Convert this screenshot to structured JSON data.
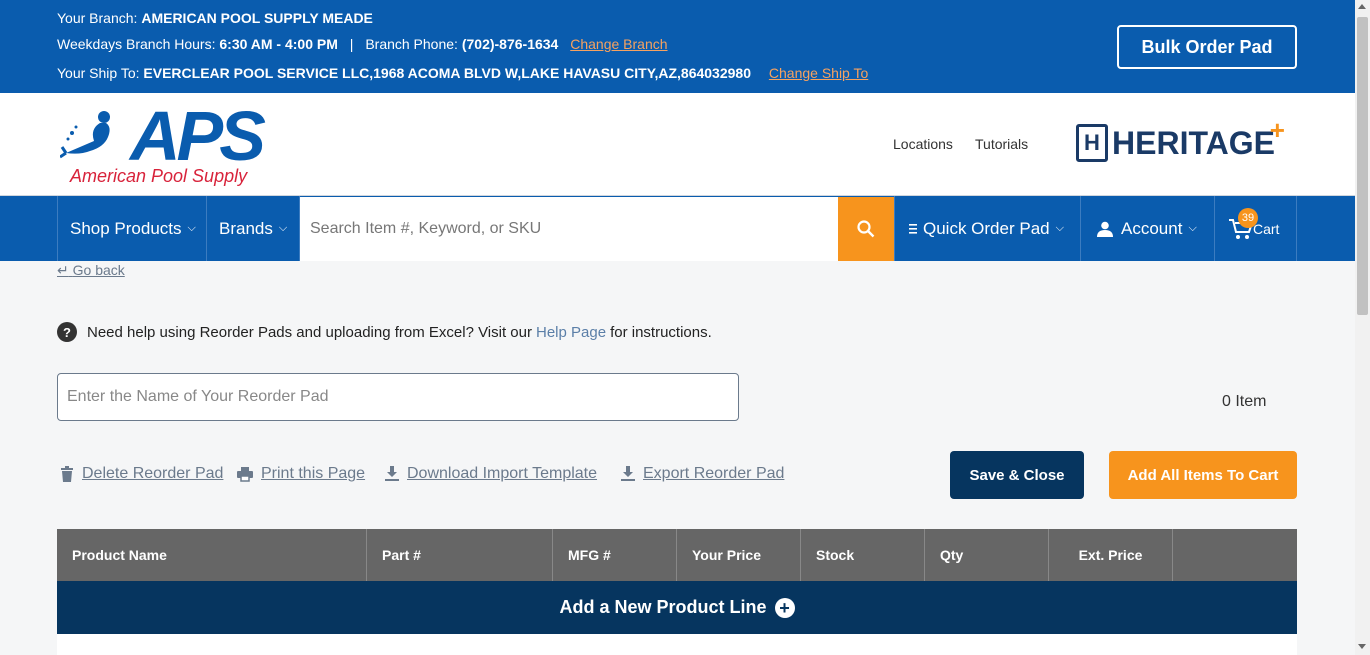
{
  "branch": {
    "branch_label": "Your Branch: ",
    "branch_name": "AMERICAN POOL SUPPLY MEADE",
    "hours_label": "Weekdays Branch Hours: ",
    "hours_value": "6:30 AM - 4:00 PM",
    "separator": "|",
    "phone_label": "Branch Phone: ",
    "phone_value": "(702)-876-1634",
    "change_branch": "Change Branch",
    "shipto_label": "Your Ship To: ",
    "shipto_value": "EVERCLEAR POOL SERVICE LLC,1968 ACOMA BLVD W,LAKE HAVASU CITY,AZ,864032980",
    "change_shipto": "Change Ship To",
    "bulk_order": "Bulk Order Pad"
  },
  "header": {
    "logo_main": "APS",
    "logo_sub": "American Pool Supply",
    "locations": "Locations",
    "tutorials": "Tutorials",
    "heritage_letter": "H",
    "heritage": "HERITAGE",
    "heritage_plus": "+"
  },
  "nav": {
    "shop_products": "Shop Products",
    "brands": "Brands",
    "search_placeholder": "Search Item #, Keyword, or SKU",
    "quick_order": "Quick Order Pad",
    "account": "Account",
    "cart": "Cart",
    "cart_count": "39"
  },
  "content": {
    "go_back": "Go back",
    "help_pre": "Need help using Reorder Pads and uploading from Excel? Visit our",
    "help_link": "Help Page",
    "help_post": "for instructions.",
    "pad_placeholder": "Enter the Name of Your Reorder Pad",
    "item_count": "0 Item",
    "actions": {
      "delete": "Delete Reorder Pad",
      "print": "Print this Page",
      "download": "Download Import Template",
      "export": "Export Reorder Pad"
    },
    "save_close": "Save & Close",
    "add_all": "Add All Items To Cart",
    "columns": [
      "Product Name",
      "Part #",
      "MFG #",
      "Your Price",
      "Stock",
      "Qty",
      "Ext. Price",
      ""
    ],
    "add_line": "Add a New Product Line"
  },
  "colors": {
    "brand_blue": "#0a5cae",
    "navy": "#06355f",
    "orange": "#f7941d",
    "table_header": "#666666"
  }
}
